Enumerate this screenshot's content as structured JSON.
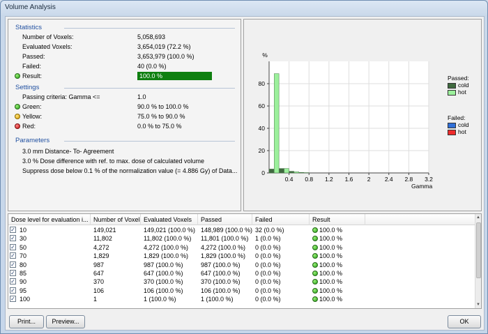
{
  "window": {
    "title": "Volume Analysis"
  },
  "statistics": {
    "title": "Statistics",
    "rows": [
      {
        "label": "Number of Voxels:",
        "value": "5,058,693"
      },
      {
        "label": "Evaluated Voxels:",
        "value": "3,654,019 (72.2 %)"
      },
      {
        "label": "Passed:",
        "value": "3,653,979 (100.0 %)"
      },
      {
        "label": "Failed:",
        "value": "40 (0.0 %)"
      }
    ],
    "result_label": "Result:",
    "result_value": "100.0 %"
  },
  "settings": {
    "title": "Settings",
    "criteria_label": "Passing criteria: Gamma <=",
    "criteria_value": "1.0",
    "green_label": "Green:",
    "green_value": "90.0 % to 100.0 %",
    "yellow_label": "Yellow:",
    "yellow_value": "75.0 % to 90.0 %",
    "red_label": "Red:",
    "red_value": "0.0 % to 75.0 %"
  },
  "parameters": {
    "title": "Parameters",
    "lines": [
      "3.0 mm Distance- To- Agreement",
      "3.0 % Dose difference with ref. to max. dose of calculated volume",
      "Suppress dose below 0.1 % of the normalization value (= 4.886 Gy) of Data..."
    ]
  },
  "legend": {
    "passed_title": "Passed:",
    "failed_title": "Failed:",
    "cold": "cold",
    "hot": "hot",
    "colors": {
      "passed_cold": "#3f6a3f",
      "passed_hot": "#9cf09c",
      "failed_cold": "#2f6fd8",
      "failed_hot": "#ee2b2b"
    }
  },
  "chart_data": {
    "type": "bar",
    "ylabel": "%",
    "xlabel": "Gamma",
    "ylim": [
      0,
      100
    ],
    "xlim": [
      0,
      3.2
    ],
    "yticks": [
      "0",
      "20",
      "40",
      "60",
      "80"
    ],
    "xticks": [
      "0.4",
      "0.8",
      "1.2",
      "1.6",
      "2",
      "2.4",
      "2.8",
      "3.2"
    ],
    "grid": true,
    "series": [
      {
        "name": "Passed: cold",
        "color": "#3f6a3f",
        "x": [
          0.05,
          0.25,
          0.45,
          0.65
        ],
        "values": [
          3.5,
          4.0,
          1.5,
          0.5
        ]
      },
      {
        "name": "Passed: hot",
        "color": "#9cf09c",
        "x": [
          0.15,
          0.35,
          0.55,
          0.75
        ],
        "values": [
          89.0,
          4.0,
          1.0,
          0.3
        ]
      }
    ]
  },
  "table": {
    "columns": [
      "Dose level for evaluation i...",
      "Number of Voxels",
      "Evaluated Voxels",
      "Passed",
      "Failed",
      "Result"
    ],
    "rows": [
      [
        "10",
        "149,021",
        "149,021 (100.0 %)",
        "148,989 (100.0 %)",
        "32 (0.0 %)",
        "100.0 %"
      ],
      [
        "30",
        "11,802",
        "11,802 (100.0 %)",
        "11,801 (100.0 %)",
        "1 (0.0 %)",
        "100.0 %"
      ],
      [
        "50",
        "4,272",
        "4,272 (100.0 %)",
        "4,272 (100.0 %)",
        "0 (0.0 %)",
        "100.0 %"
      ],
      [
        "70",
        "1,829",
        "1,829 (100.0 %)",
        "1,829 (100.0 %)",
        "0 (0.0 %)",
        "100.0 %"
      ],
      [
        "80",
        "987",
        "987 (100.0 %)",
        "987 (100.0 %)",
        "0 (0.0 %)",
        "100.0 %"
      ],
      [
        "85",
        "647",
        "647 (100.0 %)",
        "647 (100.0 %)",
        "0 (0.0 %)",
        "100.0 %"
      ],
      [
        "90",
        "370",
        "370 (100.0 %)",
        "370 (100.0 %)",
        "0 (0.0 %)",
        "100.0 %"
      ],
      [
        "95",
        "106",
        "106 (100.0 %)",
        "106 (100.0 %)",
        "0 (0.0 %)",
        "100.0 %"
      ],
      [
        "100",
        "1",
        "1 (100.0 %)",
        "1 (100.0 %)",
        "0 (0.0 %)",
        "100.0 %"
      ]
    ]
  },
  "buttons": {
    "print": "Print...",
    "preview": "Preview...",
    "ok": "OK"
  }
}
